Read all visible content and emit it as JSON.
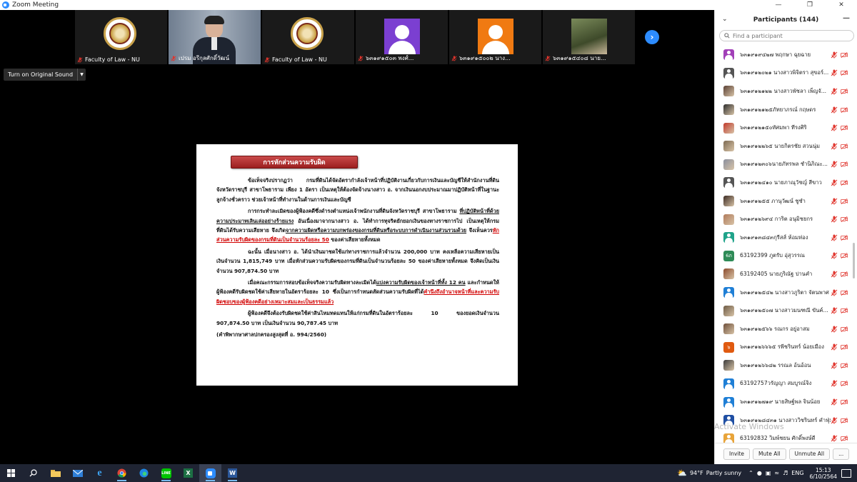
{
  "window": {
    "title": "Zoom Meeting"
  },
  "gallery": [
    {
      "name": "Faculty of Law - NU",
      "kind": "seal"
    },
    {
      "name": "เปรม อรีกุลศักดิ์วัฒน์",
      "kind": "video"
    },
    {
      "name": "Faculty of Law - NU",
      "kind": "seal"
    },
    {
      "name": "๖๓๑๙๑๕๐๓ พงศ์...",
      "kind": "avatar",
      "color": "#7b3fd1"
    },
    {
      "name": "๖๓๑๙๑๕๐๐๒ นาง...",
      "kind": "avatar",
      "color": "#f07a12"
    },
    {
      "name": "๖๓๑๙๑๕๔๐๘ นาย...",
      "kind": "photo"
    }
  ],
  "toolbar": {
    "original_sound_label": "Turn on Original Sound"
  },
  "slide": {
    "title": "การหักส่วนความรับผิด",
    "p1": "ข้อเท็จจริงปรากฏว่า กรมที่ดินได้จัดอัตรากำลังเจ้าหน้าที่ปฏิบัติงานเกี่ยวกับการเงินและบัญชีให้สำนักงานที่ดินจังหวัดราชบุรี สาขาโพธาราม เพียง 1 อัตรา เป็นเหตุให้ต้องจัดจ้างนางสาว อ. จากเงินนอกงบประมาณมาปฏิบัติหน้าที่ในฐานะลูกจ้างชั่วคราว ช่วยเจ้าหน้าที่ทำงานในด้านการเงินและบัญชี",
    "p2_a": "การกระทำละเมิดของผู้ฟ้องคดีซึ่งดำรงตำแหน่งเจ้าพนักงานที่ดินจังหวัดราชบุรี สาขาโพธาราม ",
    "p2_b": "ที่ปฏิบัติหน้าที่ด้วยความประมาทเลินเล่ออย่างร้ายแรง",
    "p2_c": " อันเนื่องมาจากนางสาว อ. ได้ทำการทุจริตยักยอกเงินของทางราชการไป เป็นเหตุให้กรมที่ดินได้รับความเสียหาย จึงเกิด",
    "p2_d": "จากความผิดหรือความบกพร่องของกรมที่ดินหรือระบบการดำเนินงานส่วนรวมด้วย",
    "p2_e": " จึงเห็นควร",
    "p2_f": "หักส่วนความรับผิดของกรมที่ดินเป็นจำนวนร้อยละ 50",
    "p2_g": " ของค่าเสียหายทั้งหมด",
    "p3": "ฉะนั้น เมื่อนางสาว อ. ได้นำเงินมาชดใช้แก่ทางราชการแล้วจำนวน 200,000 บาท คงเหลือความเสียหายเป็นเงินจำนวน 1,815,749 บาท เมื่อหักส่วนความรับผิดของกรมที่ดินเป็นจำนวนร้อยละ 50 ของค่าเสียหายทั้งหมด จึงคิดเป็นเงินจำนวน 907,874.50 บาท",
    "p4_a": "เมื่อคณะกรรมการสอบข้อเท็จจริงความรับผิดทางละเมิดได้",
    "p4_b": "แบ่งความรับผิดของเจ้าหน้าที่ทั้ง 12 คน",
    "p4_c": " และกำหนดให้ผู้ฟ้องคดีรับผิดชดใช้ค่าเสียหายในอัตราร้อยละ 10 ซึ่งเป็นการกำหนดสัดส่วนความรับผิดที่ได้",
    "p4_d": "คำนึงถึงอำนาจหน้าที่และความรับผิดชอบของผู้ฟ้องคดีอย่างเหมาะสมและเป็นธรรมแล้ว",
    "p5": "ผู้ฟ้องคดีจึงต้องรับผิดชดใช้ค่าสินไหมทดแทนให้แก่กรมที่ดินในอัตราร้อยละ 10 ของยอดเงินจำนวน 907,874.50 บาท เป็นเงินจำนวน 90,787.45 บาท",
    "citation": "(คำพิพากษาศาลปกครองสูงสุดที่ อ. 994/2560)"
  },
  "participants": {
    "header": "Participants (144)",
    "search_placeholder": "Find a participant",
    "list": [
      {
        "name": "๖๓๑๙๑๙๔๒๗ พฤกษา ฉุยฉาย",
        "color": "#a23fb8",
        "icon": "avatar"
      },
      {
        "name": "๖๓๑๙๑๒๐๒๑ นางสาวพิจิตรา สุขอร์...",
        "color": "#555555",
        "icon": "avatar"
      },
      {
        "name": "๖๓๑๙๑๒๑๒๒ นางสาวพัชลา เพ็ญจั...",
        "color": "#5a4034",
        "icon": "photo"
      },
      {
        "name": "๖๓๑๙๑๒๑๒๕ภัทยาภรณ์ กฤษดร",
        "color": "#2c2c2c",
        "icon": "photo"
      },
      {
        "name": "๖๓๑๙๑๒๑๕๐ทัศมพา ทีรงศิริ",
        "color": "#c0392b",
        "icon": "photo"
      },
      {
        "name": "๖๓๑๙๑๒๒๖๕ นายกิตรชัย สวนนุ่ม",
        "color": "#7d6a52",
        "icon": "photo"
      },
      {
        "name": "๖๓๑๙๑๒๓๐๖นายภัทรพล ชำนิภิณะ...",
        "color": "#8a8f9e",
        "icon": "photo"
      },
      {
        "name": "๖๓๑๙๑๒๔๑๐ นายภาณุวัชญ์ สีขาว",
        "color": "#555555",
        "icon": "avatar"
      },
      {
        "name": "๖๓๑๙๑๒๕๕ ภานุวัฒน์ ชูชำ",
        "color": "#3b2a22",
        "icon": "photo"
      },
      {
        "name": "๖๓๑๙๑๒๖๙๔ การิต อนุมิชยกร",
        "color": "#b07a5a",
        "icon": "photo"
      },
      {
        "name": "๖๓๑๙๑๓๘๔๓กุรีสส์ ห้อมห่อง",
        "color": "#1fa38a",
        "icon": "avatar"
      },
      {
        "name": "63192399 ภูตรับ อุ่สุวรรณ",
        "color": "#2e8b57",
        "icon": "text",
        "initials": "6ภ"
      },
      {
        "name": "63192405 นายภูริณัฐ ปานคำ",
        "color": "#8b4a2b",
        "icon": "photo"
      },
      {
        "name": "๖๓๑๙๑๒๕๔๒ นางสาวภูริตา จัตนพาศ",
        "color": "#1f7fd6",
        "icon": "avatar"
      },
      {
        "name": "๖๓๑๙๑๒๕๐๗ นางสาวมนฑณี ขันค์...",
        "color": "#6d5a44",
        "icon": "photo"
      },
      {
        "name": "๖๓๑๙๑๒๕๖๖ รณกร อยู่อาสม",
        "color": "#6e4f3a",
        "icon": "photo"
      },
      {
        "name": "๖๓๑๙๑๒๖๖๖๕ รพีชรินทร์ น้อยเมือง",
        "color": "#e05a10",
        "icon": "text",
        "initials": "๖"
      },
      {
        "name": "๖๓๑๙๑๒๖๖๘๒ รรณล อ้นอ้อน",
        "color": "#3a3a3a",
        "icon": "photo"
      },
      {
        "name": "63192757วรัญญา สมบูรณ์จิง",
        "color": "#1f7fd6",
        "icon": "avatar"
      },
      {
        "name": "๖๓๑๙๑๒๗๑๙ นายสิษฐ์พล จินน้อย",
        "color": "#1f7fd6",
        "icon": "avatar"
      },
      {
        "name": "๖๓๑๙๑๒๘๔๓๑ นางสาววิชรินทร์ คำฟุ่ม",
        "color": "#1f4fa3",
        "icon": "avatar"
      },
      {
        "name": "63192832 วิมพ์ชยน ศักดิ์พงษ์ดี",
        "color": "#e8a43a",
        "icon": "avatar"
      }
    ],
    "footer": {
      "invite": "Invite",
      "mute_all": "Mute All",
      "unmute_all": "Unmute All",
      "more": "..."
    }
  },
  "watermark": "Activate Windows",
  "taskbar": {
    "weather_temp": "94°F",
    "weather_text": "Partly sunny",
    "lang": "ENG",
    "time": "15:13",
    "date": "6/10/2564"
  }
}
